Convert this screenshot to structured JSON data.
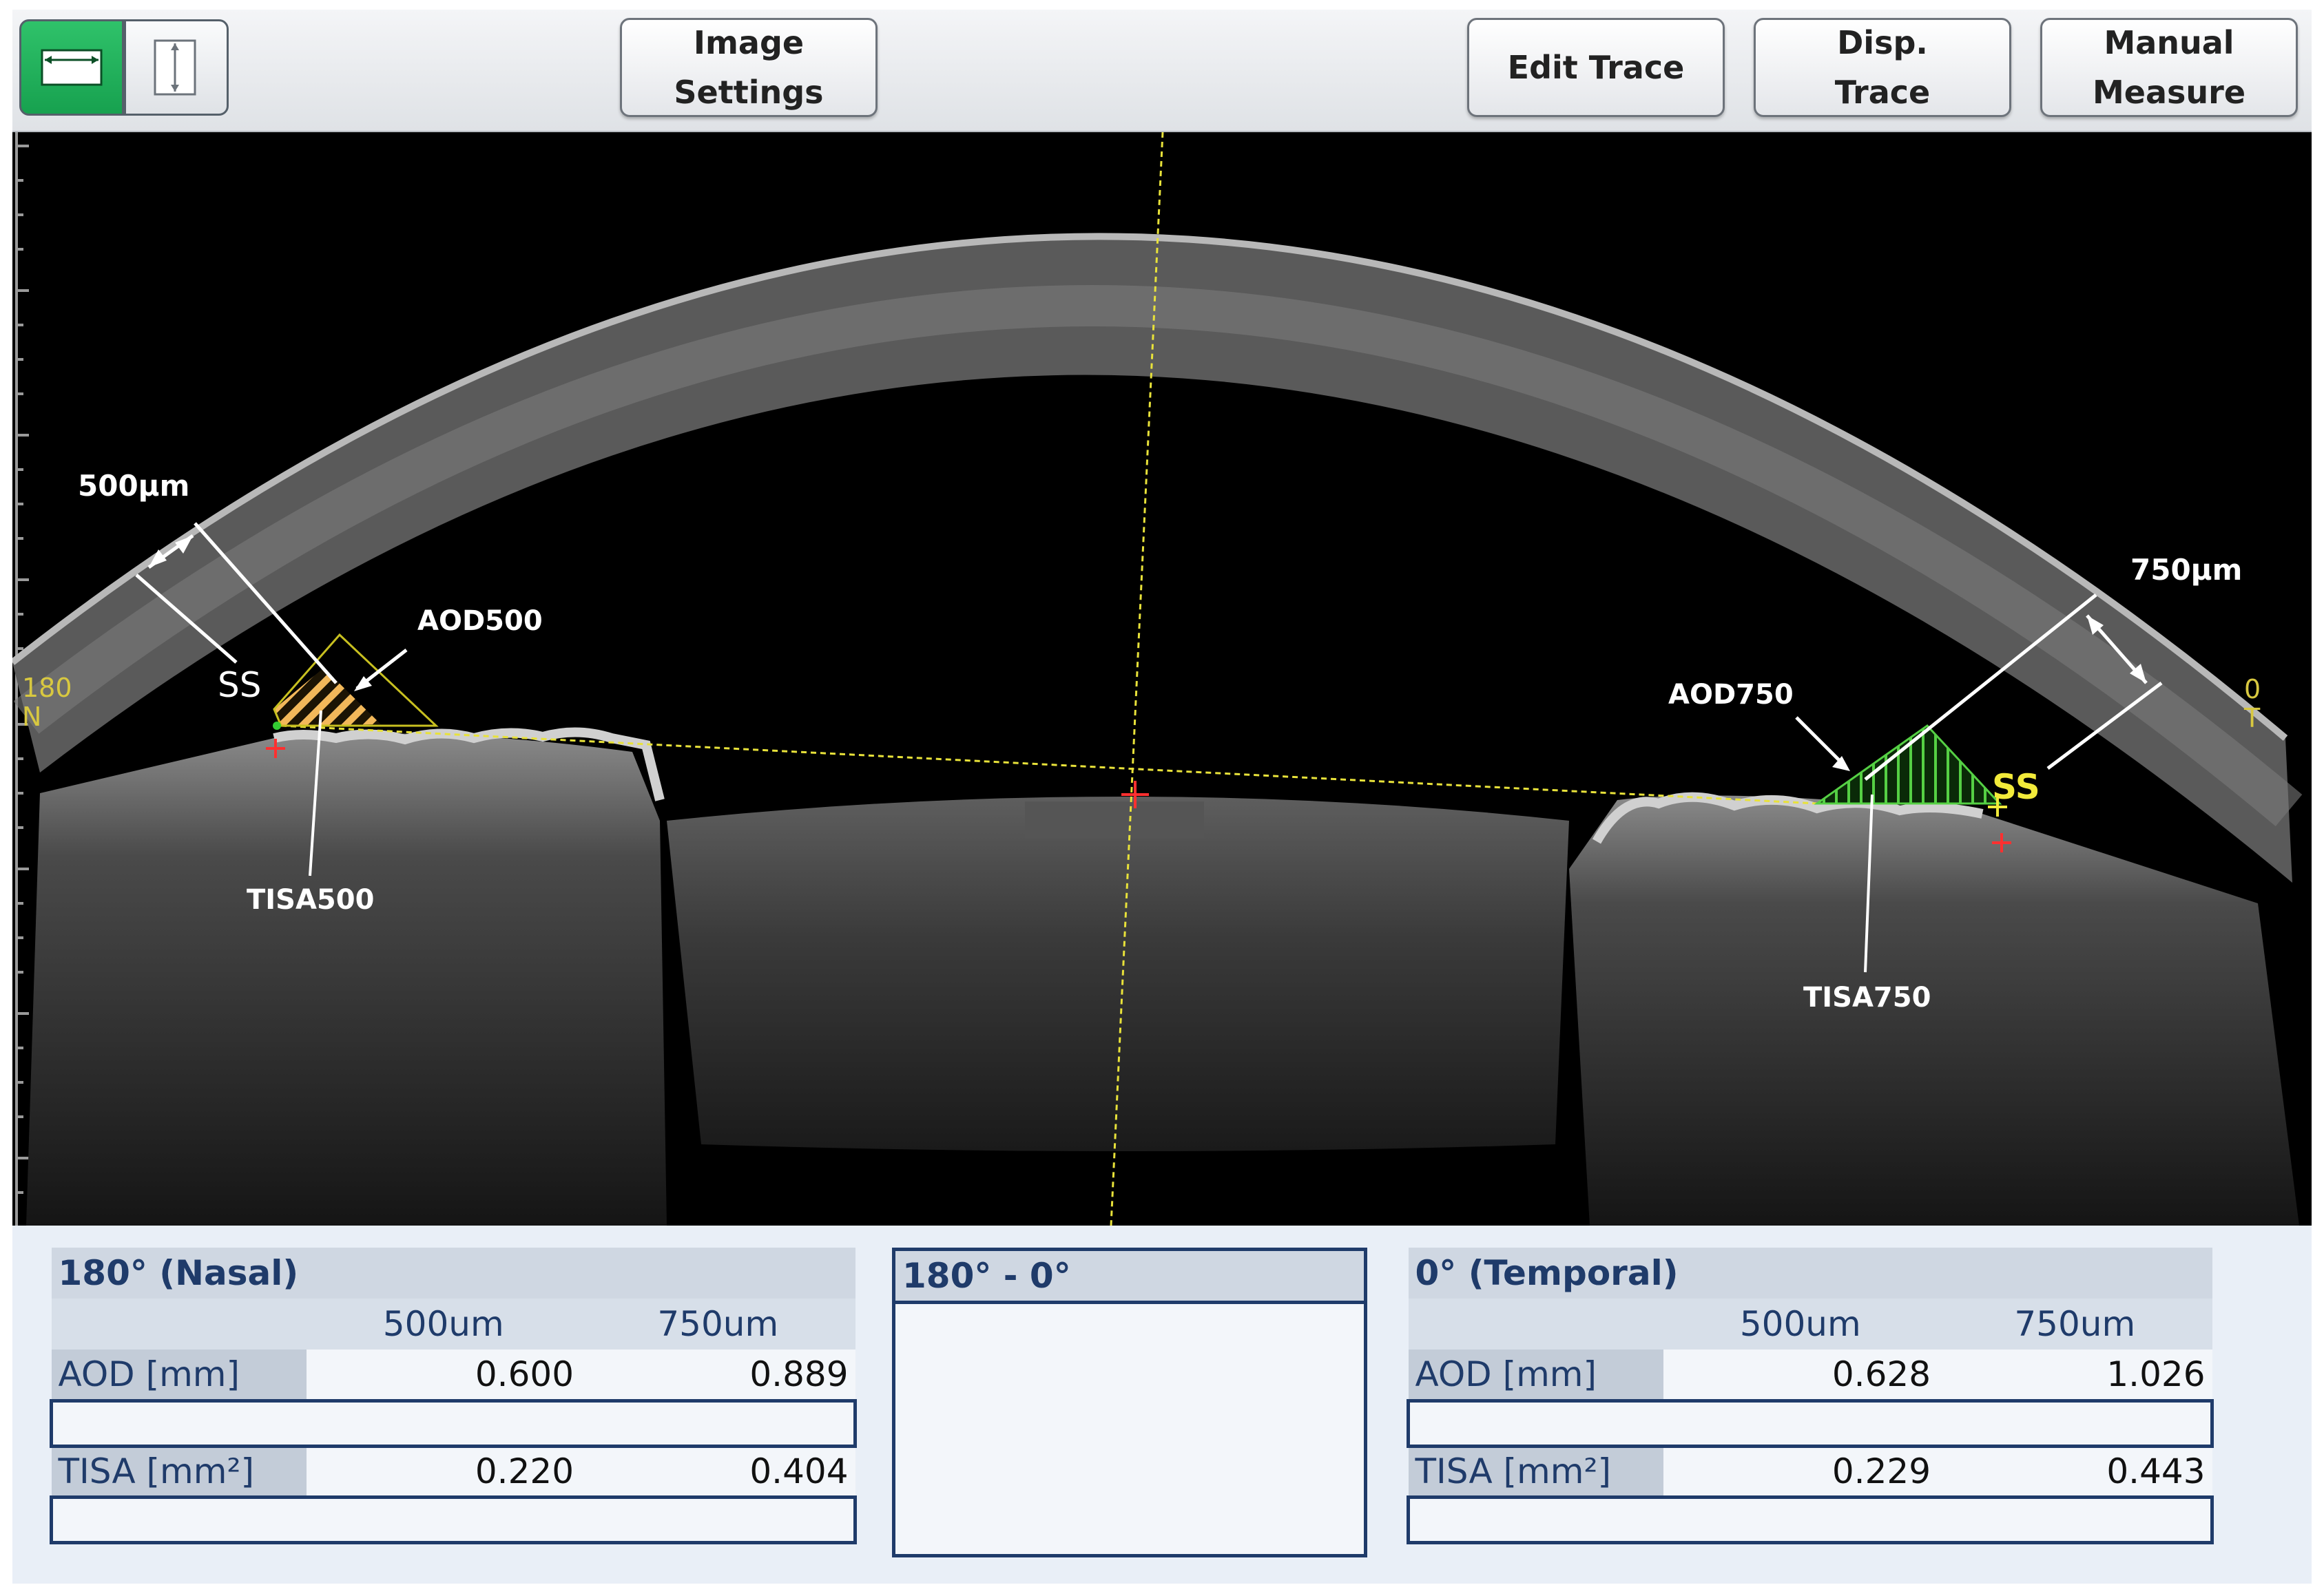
{
  "toolbar": {
    "image_settings": "Image\nSettings",
    "edit_trace": "Edit Trace",
    "disp_trace": "Disp.\nTrace",
    "manual_measure": "Manual\nMeasure"
  },
  "viewer": {
    "label_500um": "500µm",
    "label_750um": "750µm",
    "label_aod500": "AOD500",
    "label_aod750": "AOD750",
    "label_tisa500": "TISA500",
    "label_tisa750": "TISA750",
    "ss_left": "SS",
    "ss_right": "SS",
    "left_angle": "180",
    "left_dir": "N",
    "right_angle": "0",
    "right_dir": "T"
  },
  "panels": {
    "nasal": {
      "title": "180° (Nasal)",
      "col1": "500um",
      "col2": "750um",
      "aod_label": "AOD [mm]",
      "aod_500": "0.600",
      "aod_750": "0.889",
      "tisa_label": "TISA [mm²]",
      "tisa_500": "0.220",
      "tisa_750": "0.404"
    },
    "middle": {
      "title": "180° - 0°"
    },
    "temporal": {
      "title": "0° (Temporal)",
      "col1": "500um",
      "col2": "750um",
      "aod_label": "AOD [mm]",
      "aod_500": "0.628",
      "aod_750": "1.026",
      "tisa_label": "TISA [mm²]",
      "tisa_500": "0.229",
      "tisa_750": "0.443"
    }
  },
  "colors": {
    "accent_green": "#1fae5a",
    "trace_yellow": "#e8e23a",
    "panel_blue": "#1f3b6a"
  }
}
